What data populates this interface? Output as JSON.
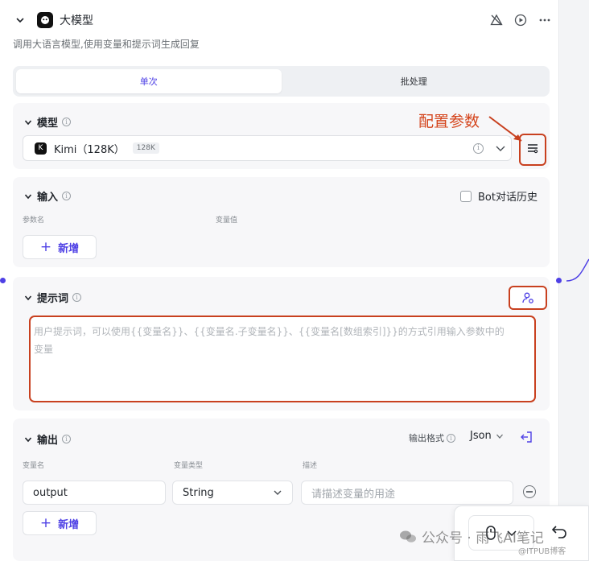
{
  "node": {
    "title": "大模型",
    "description": "调用大语言模型,使用变量和提示词生成回复"
  },
  "tabs": [
    "单次",
    "批处理"
  ],
  "model_section": {
    "title": "模型",
    "annotation": "配置参数",
    "model_name": "Kimi（128K）",
    "badge": "128K"
  },
  "input_section": {
    "title": "输入",
    "checkbox_label": "Bot对话历史",
    "col_param": "参数名",
    "col_value": "变量值",
    "add_label": "新增"
  },
  "prompt_section": {
    "title": "提示词",
    "placeholder_line1": "用户提示词，可以使用{{变量名}}、{{变量名.子变量名}}、{{变量名[数组索引]}}的方式引用输入参数中的",
    "placeholder_line2": "变量"
  },
  "output_section": {
    "title": "输出",
    "format_label": "输出格式",
    "format_value": "Json",
    "col_name": "变量名",
    "col_type": "变量类型",
    "col_desc": "描述",
    "row_name": "output",
    "row_type": "String",
    "row_desc_placeholder": "请描述变量的用途",
    "add_label": "新增"
  },
  "watermark": {
    "main": "公众号 · 雨飞AI笔记",
    "small": "@ITPUB博客"
  },
  "colors": {
    "accent": "#4e40e5",
    "annotation": "#c8401f"
  }
}
